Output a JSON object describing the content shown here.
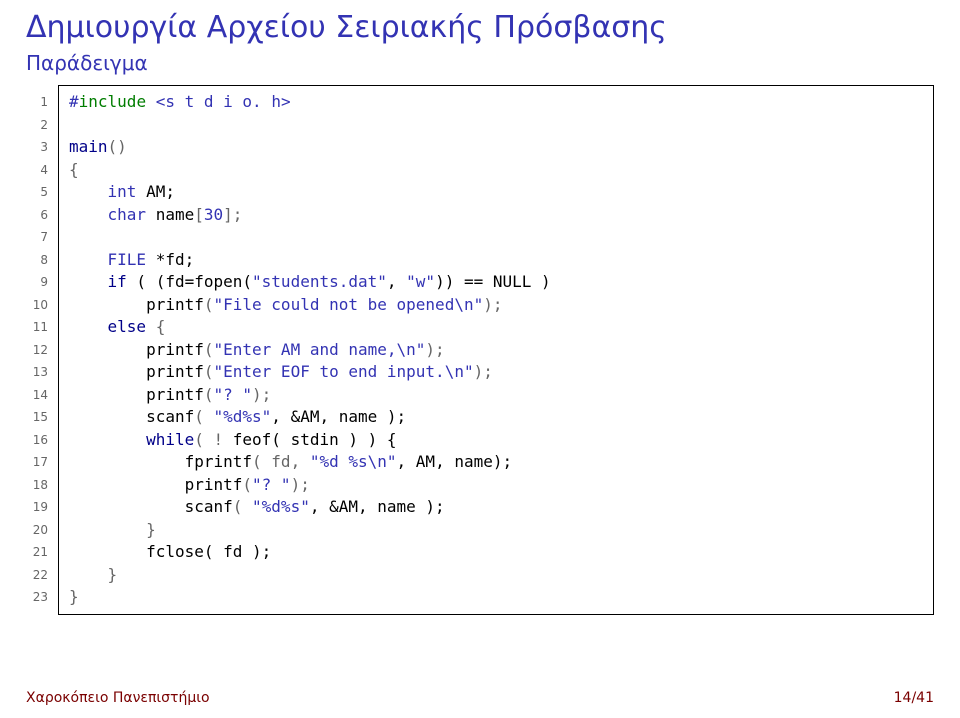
{
  "title": "Δημιουργία Αρχείου Σειριακής Πρόσβασης",
  "subtitle": "Παράδειγμα",
  "lines": [
    "1",
    "2",
    "3",
    "4",
    "5",
    "6",
    "7",
    "8",
    "9",
    "10",
    "11",
    "12",
    "13",
    "14",
    "15",
    "16",
    "17",
    "18",
    "19",
    "20",
    "21",
    "22",
    "23"
  ],
  "code": {
    "l1": {
      "pre_hash": "#",
      "pre_include": "include",
      "pre_open": " <",
      "pre_file": "s t d i o",
      "pre_close": ". h>"
    },
    "l3": {
      "main_kw": "main",
      "after": "()"
    },
    "l4": {
      "brace": "{"
    },
    "l5": {
      "indent": "    ",
      "type": "int ",
      "rest": "AM;"
    },
    "l6": {
      "indent": "    ",
      "type": "char ",
      "ident": "name",
      "dim_open": "[",
      "dim": "30",
      "dim_close": "];"
    },
    "l8": {
      "indent": "    ",
      "type": "FILE ",
      "rest": "*fd;"
    },
    "l9": {
      "indent": "    ",
      "kw": "if",
      "mid": " ( (fd=fopen(",
      "s1": "\"students.dat\"",
      "sep": ", ",
      "s2": "\"w\"",
      "close": ")) == NULL )"
    },
    "l10": {
      "indent": "        ",
      "fn": "printf",
      "open": "(",
      "s": "\"File could not be opened\\n\"",
      "close": ");"
    },
    "l11": {
      "indent": "    ",
      "kw": "else",
      "brace": " {"
    },
    "l12": {
      "indent": "        ",
      "fn": "printf",
      "open": "(",
      "s": "\"Enter AM and name,\\n\"",
      "close": ");"
    },
    "l13": {
      "indent": "        ",
      "fn": "printf",
      "open": "(",
      "s": "\"Enter EOF to end input.\\n\"",
      "close": ");"
    },
    "l14": {
      "indent": "        ",
      "fn": "printf",
      "open": "(",
      "s": "\"? \"",
      "close": ");"
    },
    "l15": {
      "indent": "        ",
      "fn": "scanf",
      "open": "( ",
      "s": "\"%d%s\"",
      "args": ", &AM, name );"
    },
    "l16": {
      "indent": "        ",
      "kw": "while",
      "open": "( ",
      "bang": "!",
      "rest": " feof( stdin ) ) {"
    },
    "l17": {
      "indent": "            ",
      "fn": "fprintf",
      "open": "( fd, ",
      "s": "\"%d %s\\n\"",
      "args": ", AM, name);"
    },
    "l18": {
      "indent": "            ",
      "fn": "printf",
      "open": "(",
      "s": "\"? \"",
      "close": ");"
    },
    "l19": {
      "indent": "            ",
      "fn": "scanf",
      "open": "( ",
      "s": "\"%d%s\"",
      "args": ", &AM, name );"
    },
    "l20": {
      "indent": "        ",
      "brace": "}"
    },
    "l21": {
      "indent": "        ",
      "fn": "fclose",
      "args": "( fd );"
    },
    "l22": {
      "indent": "    ",
      "brace": "}"
    },
    "l23": {
      "brace": "}"
    }
  },
  "footer": {
    "left": "Χαροκόπειο Πανεπιστήμιο",
    "right": "14/41"
  }
}
